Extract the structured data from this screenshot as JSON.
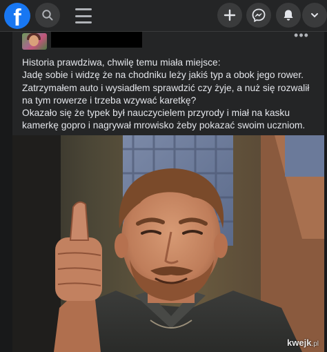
{
  "topbar": {
    "logo_letter": "f",
    "icons": {
      "logo": "facebook-logo",
      "search": "search-icon",
      "menu": "hamburger-menu-icon",
      "create": "plus-icon",
      "messenger": "messenger-icon",
      "notifications": "bell-icon"
    }
  },
  "post": {
    "lines": [
      "Historia prawdziwa, chwilę temu miała miejsce:",
      "Jadę sobie i widzę że na chodniku leży jakiś typ a obok jego rower.",
      "Zatrzymałem auto i wysiadłem sprawdzić czy żyje, a nuż się rozwalił na tym rowerze i trzeba wzywać karetkę?",
      "Okazało się że typek był nauczycielem przyrody i miał na kasku kamerkę gopro i nagrywał mrowisko żeby pokazać swoim uczniom."
    ],
    "more_icon": "ellipsis-icon"
  },
  "image": {
    "subject": "thumbs-up-man",
    "watermark_main": "kwejk",
    "watermark_tld": ".pl"
  },
  "colors": {
    "background": "#18191a",
    "surface": "#242526",
    "button": "#3a3b3c",
    "brand": "#1877f2",
    "text": "#e4e6eb",
    "icon": "#e4e6eb"
  }
}
